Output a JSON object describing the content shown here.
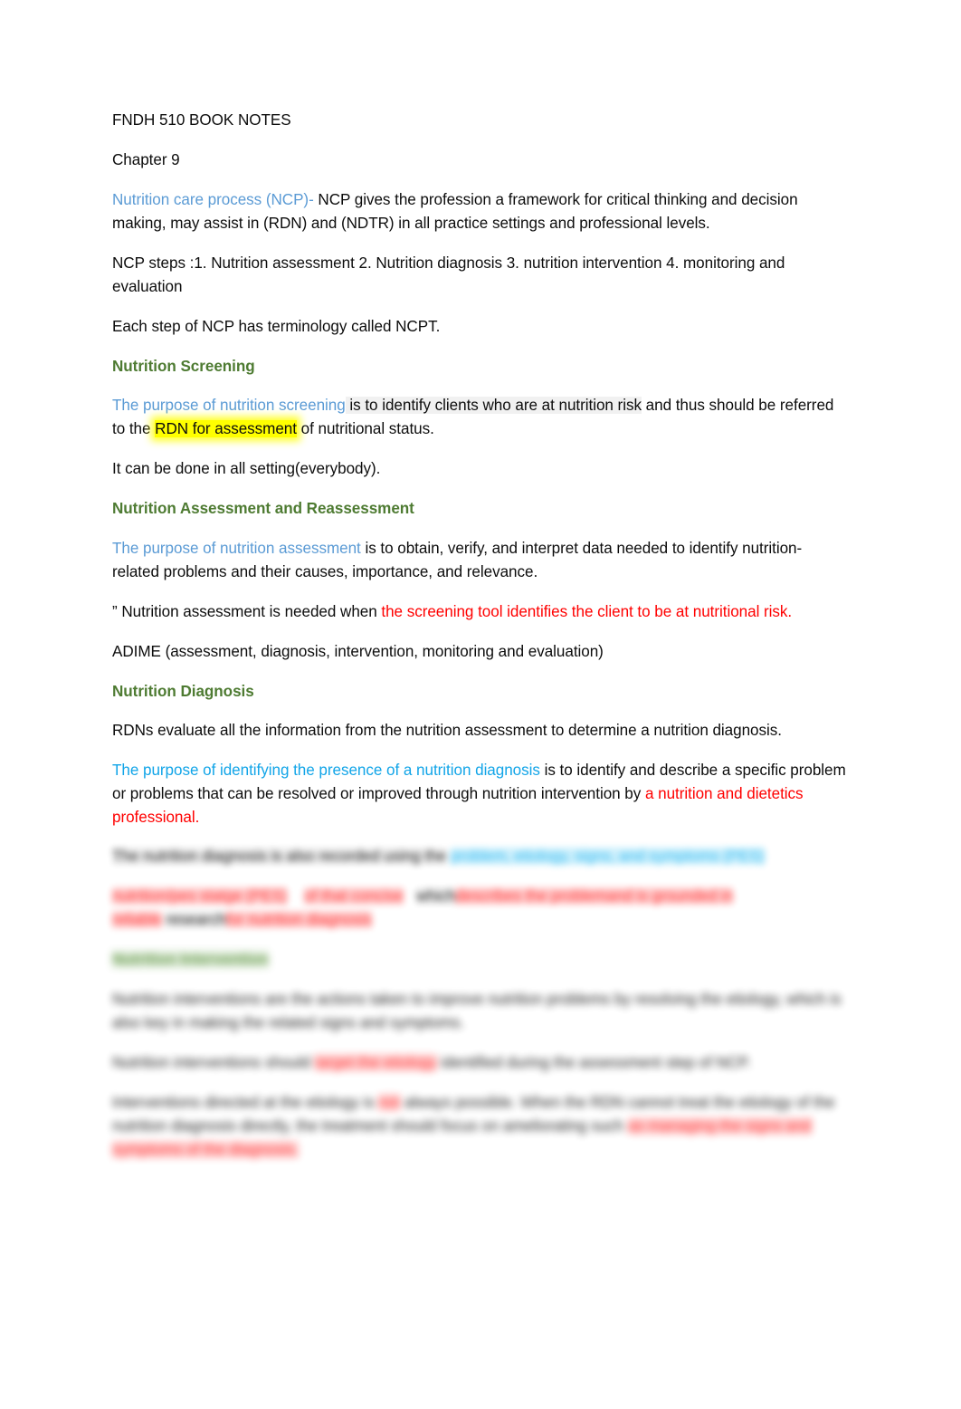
{
  "document": {
    "title": "FNDH 510 BOOK NOTES",
    "chapter": "Chapter 9",
    "colors": {
      "heading_green": "#4E7B32",
      "blue_muted": "#5B9BD5",
      "blue_bright": "#12A5E8",
      "red": "#FF0000",
      "highlight_yellow": "#FFFF00",
      "shading_gray": "rgba(0,0,0,0.055)",
      "body_text": "#0D0D0D",
      "page_background": "#FFFFFF"
    },
    "blocks": {
      "ncp_intro": {
        "lead": "Nutrition care process (NCP)-",
        "rest": " NCP gives the profession a framework for critical thinking and decision making, may assist in (RDN) and (NDTR) in all practice settings and professional levels."
      },
      "ncp_steps": "NCP steps :1. Nutrition assessment 2. Nutrition diagnosis 3. nutrition intervention 4. monitoring and evaluation",
      "ncpt": "Each step of NCP has terminology called NCPT.",
      "heading_screening": "Nutrition Screening",
      "screening_purpose": {
        "lead": "The purpose of nutrition screening",
        "mid": " is to identify clients who are at nutrition risk",
        "after_shade": " and thus should be referred to the ",
        "highlight": "RDN for assessment",
        "tail": " of nutritional status."
      },
      "screening_setting": "It can be done in all setting(everybody).",
      "heading_assessment": "Nutrition Assessment and Reassessment",
      "assessment_purpose": {
        "lead": "The purpose of nutrition assessment",
        "rest": " is to obtain, verify, and interpret data needed to identify nutrition-related problems and their causes, importance, and relevance."
      },
      "assessment_needed": {
        "lead": "” Nutrition assessment is needed when ",
        "red": "the screening tool identifies the client to be at nutritional risk."
      },
      "adime": "ADIME (assessment, diagnosis, intervention, monitoring and evaluation)",
      "heading_diagnosis": "Nutrition Diagnosis",
      "diagnosis_rdns": "RDNs evaluate all the information from the nutrition assessment to determine a nutrition diagnosis.",
      "diagnosis_purpose": {
        "lead": "The purpose of identifying the presence of a nutrition diagnosis",
        "mid": " is to identify and describe a specific problem or problems that can be resolved or improved through nutrition intervention by ",
        "red": "a nutrition and dietetics professional."
      }
    },
    "obscured": {
      "note": "Lower portion of page is blurred and illegible",
      "line1_black": "The nutrition diagnosis is also recorded using the",
      "line1_blue": "problem, etiology, signs, and symptoms (PES)",
      "line2_red_a": "nutrition/pes statge (PES)",
      "line2_red_b": "of that concise",
      "line2_gray": "which",
      "line2_red_c": "describes the problem",
      "line3_red_a": "and is grounded in reliable",
      "line3_gray": "research",
      "line3_red_b": "for nutrition diagnosis",
      "heading_green": "Nutrition Intervention",
      "para1": "Nutrition interventions are the actions taken to improve nutrition problems by resolving the etiology, which is also key in making the related signs and symptoms.",
      "para2_lead": "Nutrition interventions should",
      "para2_red": "target the etiology",
      "para2_tail": "identified during the assessment step of NCP.",
      "para3_lead": "Interventions directed at the etiology is",
      "para3_red": "not",
      "para3_mid": "always possible. When the RDN cannot treat the etiology of the nutrition diagnosis directly, the treatment should focus on ameliorating such",
      "para3_red2": "as managing the signs and symptoms of the diagnosis."
    }
  }
}
